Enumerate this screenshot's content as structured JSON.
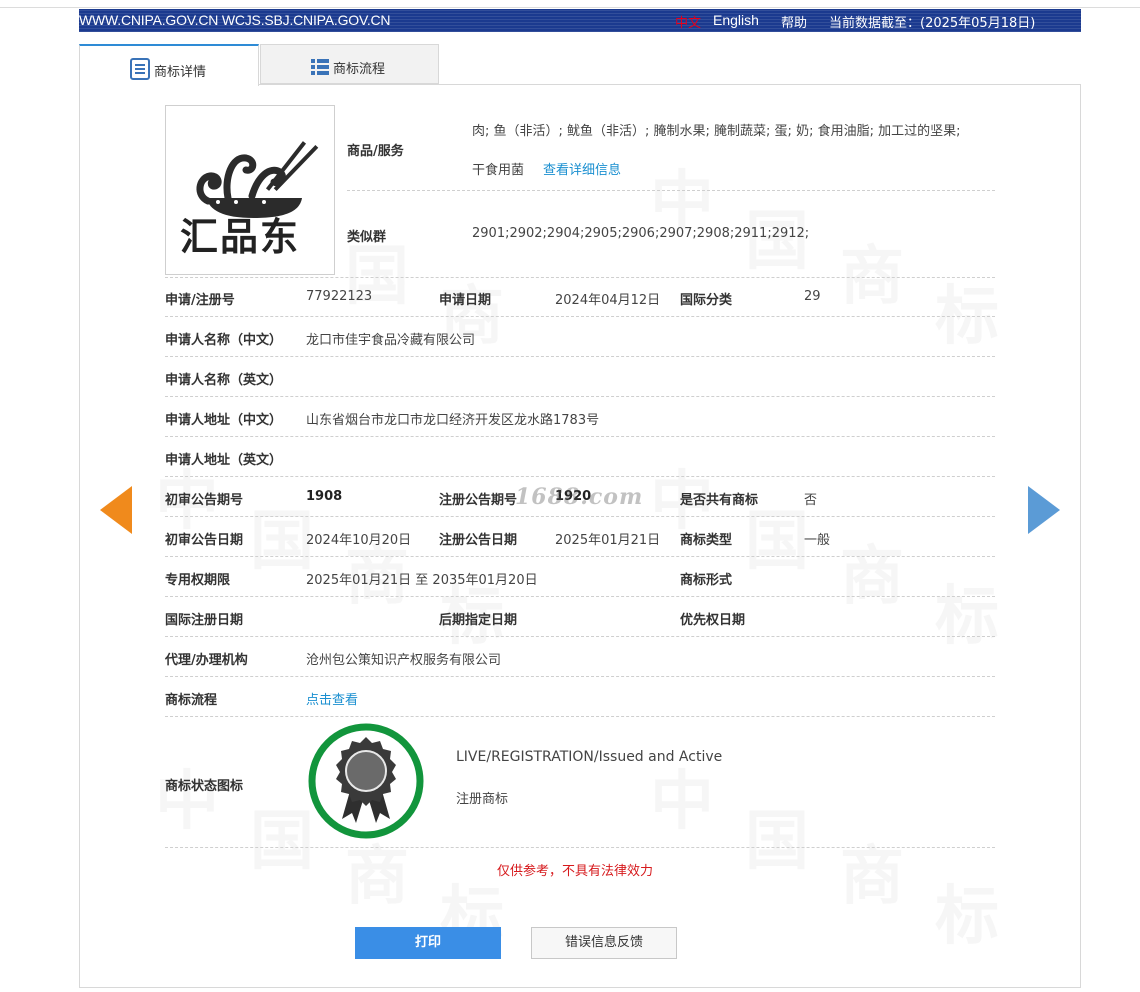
{
  "topbar": {
    "sites": "WWW.CNIPA.GOV.CN WCJS.SBJ.CNIPA.GOV.CN",
    "lang_zh": "中文",
    "lang_en": "English",
    "help": "帮助",
    "data_as_of": "当前数据截至：(2025年05月18日)"
  },
  "tabs": {
    "detail": "商标详情",
    "flow": "商标流程"
  },
  "logo": {
    "text": "汇品东"
  },
  "goods": {
    "label": "商品/服务",
    "line1": "肉; 鱼（非活）; 鱿鱼（非活）; 腌制水果; 腌制蔬菜; 蛋; 奶; 食用油脂; 加工过的坚果;",
    "line2": "干食用菌",
    "detail_link": "查看详细信息"
  },
  "similar_group": {
    "label": "类似群",
    "value": "2901;2902;2904;2905;2906;2907;2908;2911;2912;"
  },
  "fields": {
    "reg_no_label": "申请/注册号",
    "reg_no": "77922123",
    "app_date_label": "申请日期",
    "app_date": "2024年04月12日",
    "intl_class_label": "国际分类",
    "intl_class": "29",
    "applicant_cn_label": "申请人名称（中文）",
    "applicant_cn": "龙口市佳宇食品冷藏有限公司",
    "applicant_en_label": "申请人名称（英文）",
    "applicant_en": "",
    "address_cn_label": "申请人地址（中文）",
    "address_cn": "山东省烟台市龙口市龙口经济开发区龙水路1783号",
    "address_en_label": "申请人地址（英文）",
    "address_en": "",
    "prelim_issue_label": "初审公告期号",
    "prelim_issue": "1908",
    "reg_issue_label": "注册公告期号",
    "reg_issue": "1920",
    "shared_label": "是否共有商标",
    "shared": "否",
    "prelim_date_label": "初审公告日期",
    "prelim_date": "2024年10月20日",
    "reg_date_label": "注册公告日期",
    "reg_date": "2025年01月21日",
    "mark_type_label": "商标类型",
    "mark_type": "一般",
    "term_label": "专用权期限",
    "term": "2025年01月21日 至 2035年01月20日",
    "mark_form_label": "商标形式",
    "mark_form": "",
    "intl_reg_date_label": "国际注册日期",
    "intl_reg_date": "",
    "later_designation_label": "后期指定日期",
    "later_designation": "",
    "priority_date_label": "优先权日期",
    "priority_date": "",
    "agent_label": "代理/办理机构",
    "agent": "沧州包公策知识产权服务有限公司",
    "flow_label": "商标流程",
    "flow_link": "点击查看",
    "status_label": "商标状态图标",
    "status_en": "LIVE/REGISTRATION/Issued and Active",
    "status_cn": "注册商标"
  },
  "overlay_mark": "1688.com",
  "notice": "仅供参考，不具有法律效力",
  "buttons": {
    "print": "打印",
    "feedback": "错误信息反馈"
  },
  "colors": {
    "topbar": "#1b3a8f",
    "link": "#1a8fd0",
    "arrow_left": "#f08a1c",
    "arrow_right": "#5b9bd6",
    "status_ring": "#12953c",
    "notice": "#d6191c",
    "print_button": "#3a8ee6"
  },
  "icons": {
    "detail_tab": "document-list-icon",
    "flow_tab": "list-grid-icon",
    "status": "award-ribbon-icon",
    "prev": "arrow-left-icon",
    "next": "arrow-right-icon"
  }
}
